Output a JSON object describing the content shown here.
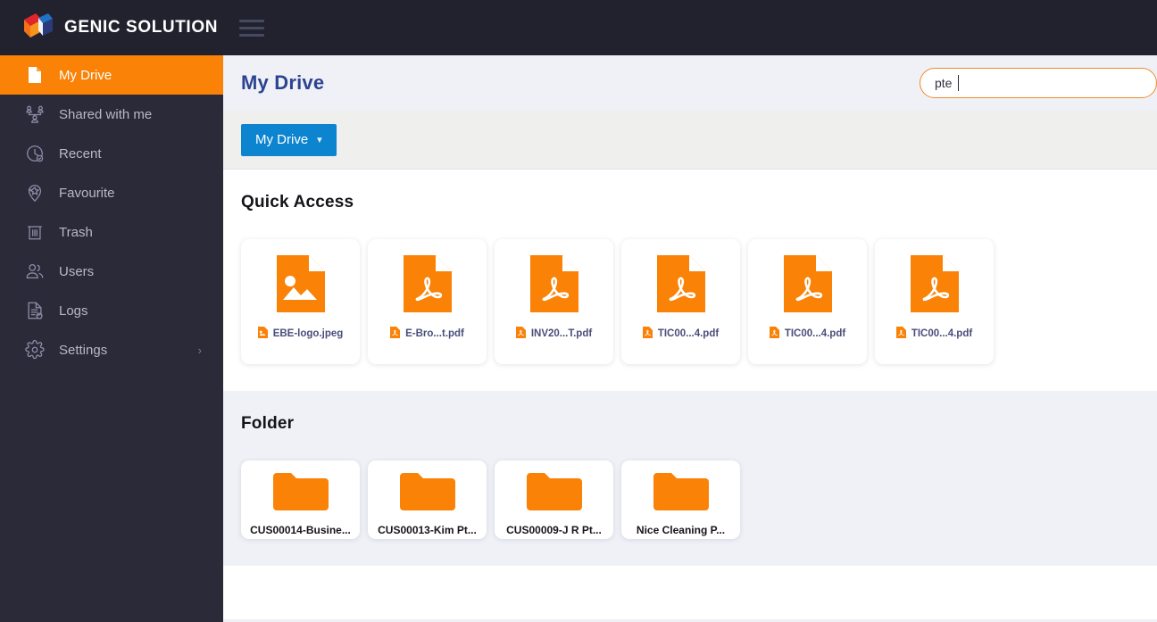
{
  "topbar": {
    "brand_name": "GENIC SOLUTION",
    "logo_icon": "cube-logo-icon",
    "menu_icon": "hamburger-menu-icon",
    "background": "#22222e"
  },
  "sidebar": {
    "background": "#2a2a38",
    "active_color": "#f98207",
    "items": [
      {
        "label": "My Drive",
        "icon": "file-icon",
        "active": true,
        "chevron": ""
      },
      {
        "label": "Shared with me",
        "icon": "share-users-icon",
        "active": false,
        "chevron": ""
      },
      {
        "label": "Recent",
        "icon": "clock-check-icon",
        "active": false,
        "chevron": ""
      },
      {
        "label": "Favourite",
        "icon": "map-pin-star-icon",
        "active": false,
        "chevron": ""
      },
      {
        "label": "Trash",
        "icon": "trash-icon",
        "active": false,
        "chevron": ""
      },
      {
        "label": "Users",
        "icon": "users-icon",
        "active": false,
        "chevron": ""
      },
      {
        "label": "Logs",
        "icon": "log-document-icon",
        "active": false,
        "chevron": ""
      },
      {
        "label": "Settings",
        "icon": "gear-icon",
        "active": false,
        "chevron": "›"
      }
    ]
  },
  "header": {
    "title": "My Drive",
    "title_color": "#2c4490"
  },
  "search": {
    "value": "pte",
    "placeholder": "",
    "border_color": "#f0892a",
    "icon": "search-input-caret"
  },
  "toolbar": {
    "drive_button_label": "My Drive",
    "drive_button_color": "#0d84d0",
    "dropdown_icon": "chevron-down-icon"
  },
  "quick_access": {
    "title": "Quick Access",
    "files": [
      {
        "name": "EBE-logo.jpeg",
        "type": "image",
        "badge": "image-file-badge-icon"
      },
      {
        "name": "E-Bro...t.pdf",
        "type": "pdf",
        "badge": "pdf-file-badge-icon"
      },
      {
        "name": "INV20...T.pdf",
        "type": "pdf",
        "badge": "pdf-file-badge-icon"
      },
      {
        "name": "TIC00...4.pdf",
        "type": "pdf",
        "badge": "pdf-file-badge-icon"
      },
      {
        "name": "TIC00...4.pdf",
        "type": "pdf",
        "badge": "pdf-file-badge-icon"
      },
      {
        "name": "TIC00...4.pdf",
        "type": "pdf",
        "badge": "pdf-file-badge-icon"
      }
    ]
  },
  "folders": {
    "title": "Folder",
    "items": [
      {
        "name": "CUS00014-Busine...",
        "icon": "folder-icon"
      },
      {
        "name": "CUS00013-Kim Pt...",
        "icon": "folder-icon"
      },
      {
        "name": "CUS00009-J R Pt...",
        "icon": "folder-icon"
      },
      {
        "name": "Nice Cleaning P...",
        "icon": "folder-icon"
      }
    ]
  },
  "theme": {
    "page_background": "#f0f1f7",
    "panel_background": "#ffffff",
    "accent_orange": "#f98207",
    "accent_blue": "#0d84d0"
  }
}
